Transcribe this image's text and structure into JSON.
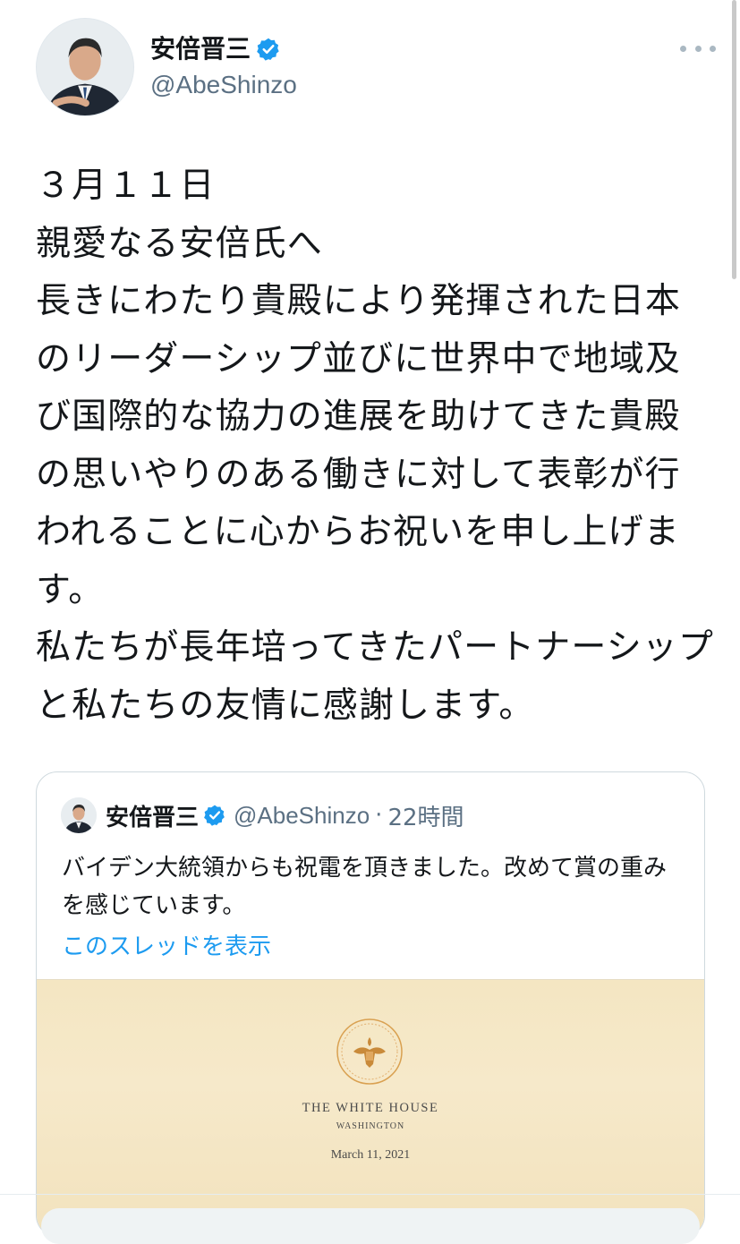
{
  "tweet": {
    "display_name": "安倍晋三",
    "handle": "@AbeShinzo",
    "verified": true,
    "avatar_icon": "avatar-photo-icon",
    "more_icon": "more-options-icon",
    "body": "３月１１日\n親愛なる安倍氏へ\n長きにわたり貴殿により発揮された日本のリーダーシップ並びに世界中で地域及び国際的な協力の進展を助けてきた貴殿の思いやりのある働きに対して表彰が行われることに心からお祝いを申し上げます。\n私たちが長年培ってきたパートナーシップと私たちの友情に感謝します。"
  },
  "quoted_tweet": {
    "display_name": "安倍晋三",
    "handle": "@AbeShinzo",
    "separator": "·",
    "time": "22時間",
    "text": "バイデン大統領からも祝電を頂きました。改めて賞の重みを感じています。",
    "thread_link": "このスレッドを表示",
    "image": {
      "letterhead_title": "THE WHITE HOUSE",
      "letterhead_subtitle": "WASHINGTON",
      "letter_date": "March 11, 2021"
    }
  },
  "colors": {
    "verified_blue": "#1d9bf0",
    "secondary_text": "#5b7083",
    "link": "#1d9bf0",
    "border": "#cfd9de"
  }
}
